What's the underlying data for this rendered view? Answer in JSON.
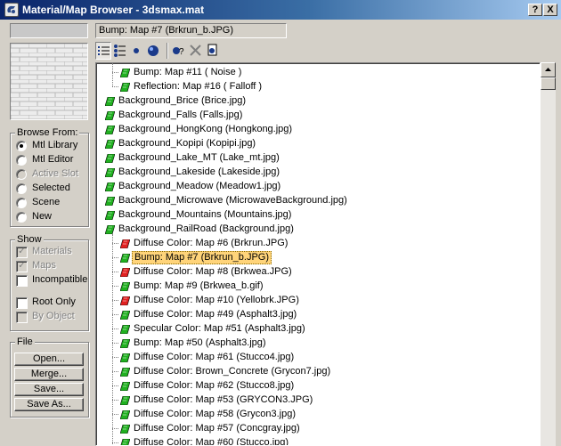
{
  "window": {
    "title": "Material/Map Browser - 3dsmax.mat",
    "help_label": "?",
    "close_label": "X"
  },
  "name_field": {
    "value": "Bump: Map #7 (Brkrun_b.JPG)"
  },
  "browse_from": {
    "title": "Browse From:",
    "options": [
      {
        "label": "Mtl Library",
        "checked": true,
        "disabled": false
      },
      {
        "label": "Mtl Editor",
        "checked": false,
        "disabled": false
      },
      {
        "label": "Active Slot",
        "checked": false,
        "disabled": true
      },
      {
        "label": "Selected",
        "checked": false,
        "disabled": false
      },
      {
        "label": "Scene",
        "checked": false,
        "disabled": false
      },
      {
        "label": "New",
        "checked": false,
        "disabled": false
      }
    ]
  },
  "show": {
    "title": "Show",
    "options": [
      {
        "label": "Materials",
        "checked": true,
        "disabled": true
      },
      {
        "label": "Maps",
        "checked": true,
        "disabled": true
      },
      {
        "label": "Incompatible",
        "checked": false,
        "disabled": false
      },
      {
        "label": "Root Only",
        "checked": false,
        "disabled": false
      },
      {
        "label": "By Object",
        "checked": false,
        "disabled": true
      }
    ]
  },
  "file": {
    "title": "File",
    "buttons": [
      "Open...",
      "Merge...",
      "Save...",
      "Save As..."
    ]
  },
  "toolbar": {
    "tools": [
      "view-list-icon",
      "view-list-icons-icon",
      "view-small-icons-icon",
      "view-large-icons-icon",
      "update-scene-materials-icon",
      "delete-from-library-icon",
      "clear-library-icon"
    ]
  },
  "list": {
    "items": [
      {
        "label": "Bump: Map #11  ( Noise )",
        "indent": 1,
        "icon": "green",
        "selected": false
      },
      {
        "label": "Reflection: Map #16  ( Falloff )",
        "indent": 1,
        "icon": "green",
        "selected": false
      },
      {
        "label": "Background_Brice (Brice.jpg)",
        "indent": 0,
        "icon": "green",
        "selected": false
      },
      {
        "label": "Background_Falls (Falls.jpg)",
        "indent": 0,
        "icon": "green",
        "selected": false
      },
      {
        "label": "Background_HongKong (Hongkong.jpg)",
        "indent": 0,
        "icon": "green",
        "selected": false
      },
      {
        "label": "Background_Kopipi (Kopipi.jpg)",
        "indent": 0,
        "icon": "green",
        "selected": false
      },
      {
        "label": "Background_Lake_MT (Lake_mt.jpg)",
        "indent": 0,
        "icon": "green",
        "selected": false
      },
      {
        "label": "Background_Lakeside (Lakeside.jpg)",
        "indent": 0,
        "icon": "green",
        "selected": false
      },
      {
        "label": "Background_Meadow (Meadow1.jpg)",
        "indent": 0,
        "icon": "green",
        "selected": false
      },
      {
        "label": "Background_Microwave (MicrowaveBackground.jpg)",
        "indent": 0,
        "icon": "green",
        "selected": false
      },
      {
        "label": "Background_Mountains (Mountains.jpg)",
        "indent": 0,
        "icon": "green",
        "selected": false
      },
      {
        "label": "Background_RailRoad (Background.jpg)",
        "indent": 0,
        "icon": "green",
        "selected": false
      },
      {
        "label": "Diffuse Color: Map #6 (Brkrun.JPG)",
        "indent": 1,
        "icon": "red",
        "selected": false
      },
      {
        "label": "Bump: Map #7 (Brkrun_b.JPG)",
        "indent": 1,
        "icon": "green",
        "selected": true
      },
      {
        "label": "Diffuse Color: Map #8 (Brkwea.JPG)",
        "indent": 1,
        "icon": "red",
        "selected": false
      },
      {
        "label": "Bump: Map #9 (Brkwea_b.gif)",
        "indent": 1,
        "icon": "green",
        "selected": false
      },
      {
        "label": "Diffuse Color: Map #10 (Yellobrk.JPG)",
        "indent": 1,
        "icon": "red",
        "selected": false
      },
      {
        "label": "Diffuse Color: Map #49 (Asphalt3.jpg)",
        "indent": 1,
        "icon": "green",
        "selected": false
      },
      {
        "label": "Specular Color: Map #51 (Asphalt3.jpg)",
        "indent": 1,
        "icon": "green",
        "selected": false
      },
      {
        "label": "Bump: Map #50 (Asphalt3.jpg)",
        "indent": 1,
        "icon": "green",
        "selected": false
      },
      {
        "label": "Diffuse Color: Map #61 (Stucco4.jpg)",
        "indent": 1,
        "icon": "green",
        "selected": false
      },
      {
        "label": "Diffuse Color: Brown_Concrete (Grycon7.jpg)",
        "indent": 1,
        "icon": "green",
        "selected": false
      },
      {
        "label": "Diffuse Color: Map #62 (Stucco8.jpg)",
        "indent": 1,
        "icon": "green",
        "selected": false
      },
      {
        "label": "Diffuse Color: Map #53 (GRYCON3.JPG)",
        "indent": 1,
        "icon": "green",
        "selected": false
      },
      {
        "label": "Diffuse Color: Map #58 (Grycon3.jpg)",
        "indent": 1,
        "icon": "green",
        "selected": false
      },
      {
        "label": "Diffuse Color: Map #57 (Concgray.jpg)",
        "indent": 1,
        "icon": "green",
        "selected": false
      },
      {
        "label": "Diffuse Color: Map #60 (Stucco.jpg)",
        "indent": 1,
        "icon": "green",
        "selected": false
      }
    ]
  },
  "colors": {
    "title_start": "#0a246a",
    "title_end": "#a6caf0",
    "selection": "#ffd47a",
    "map_green": "#20b020",
    "map_red": "#e02020"
  }
}
